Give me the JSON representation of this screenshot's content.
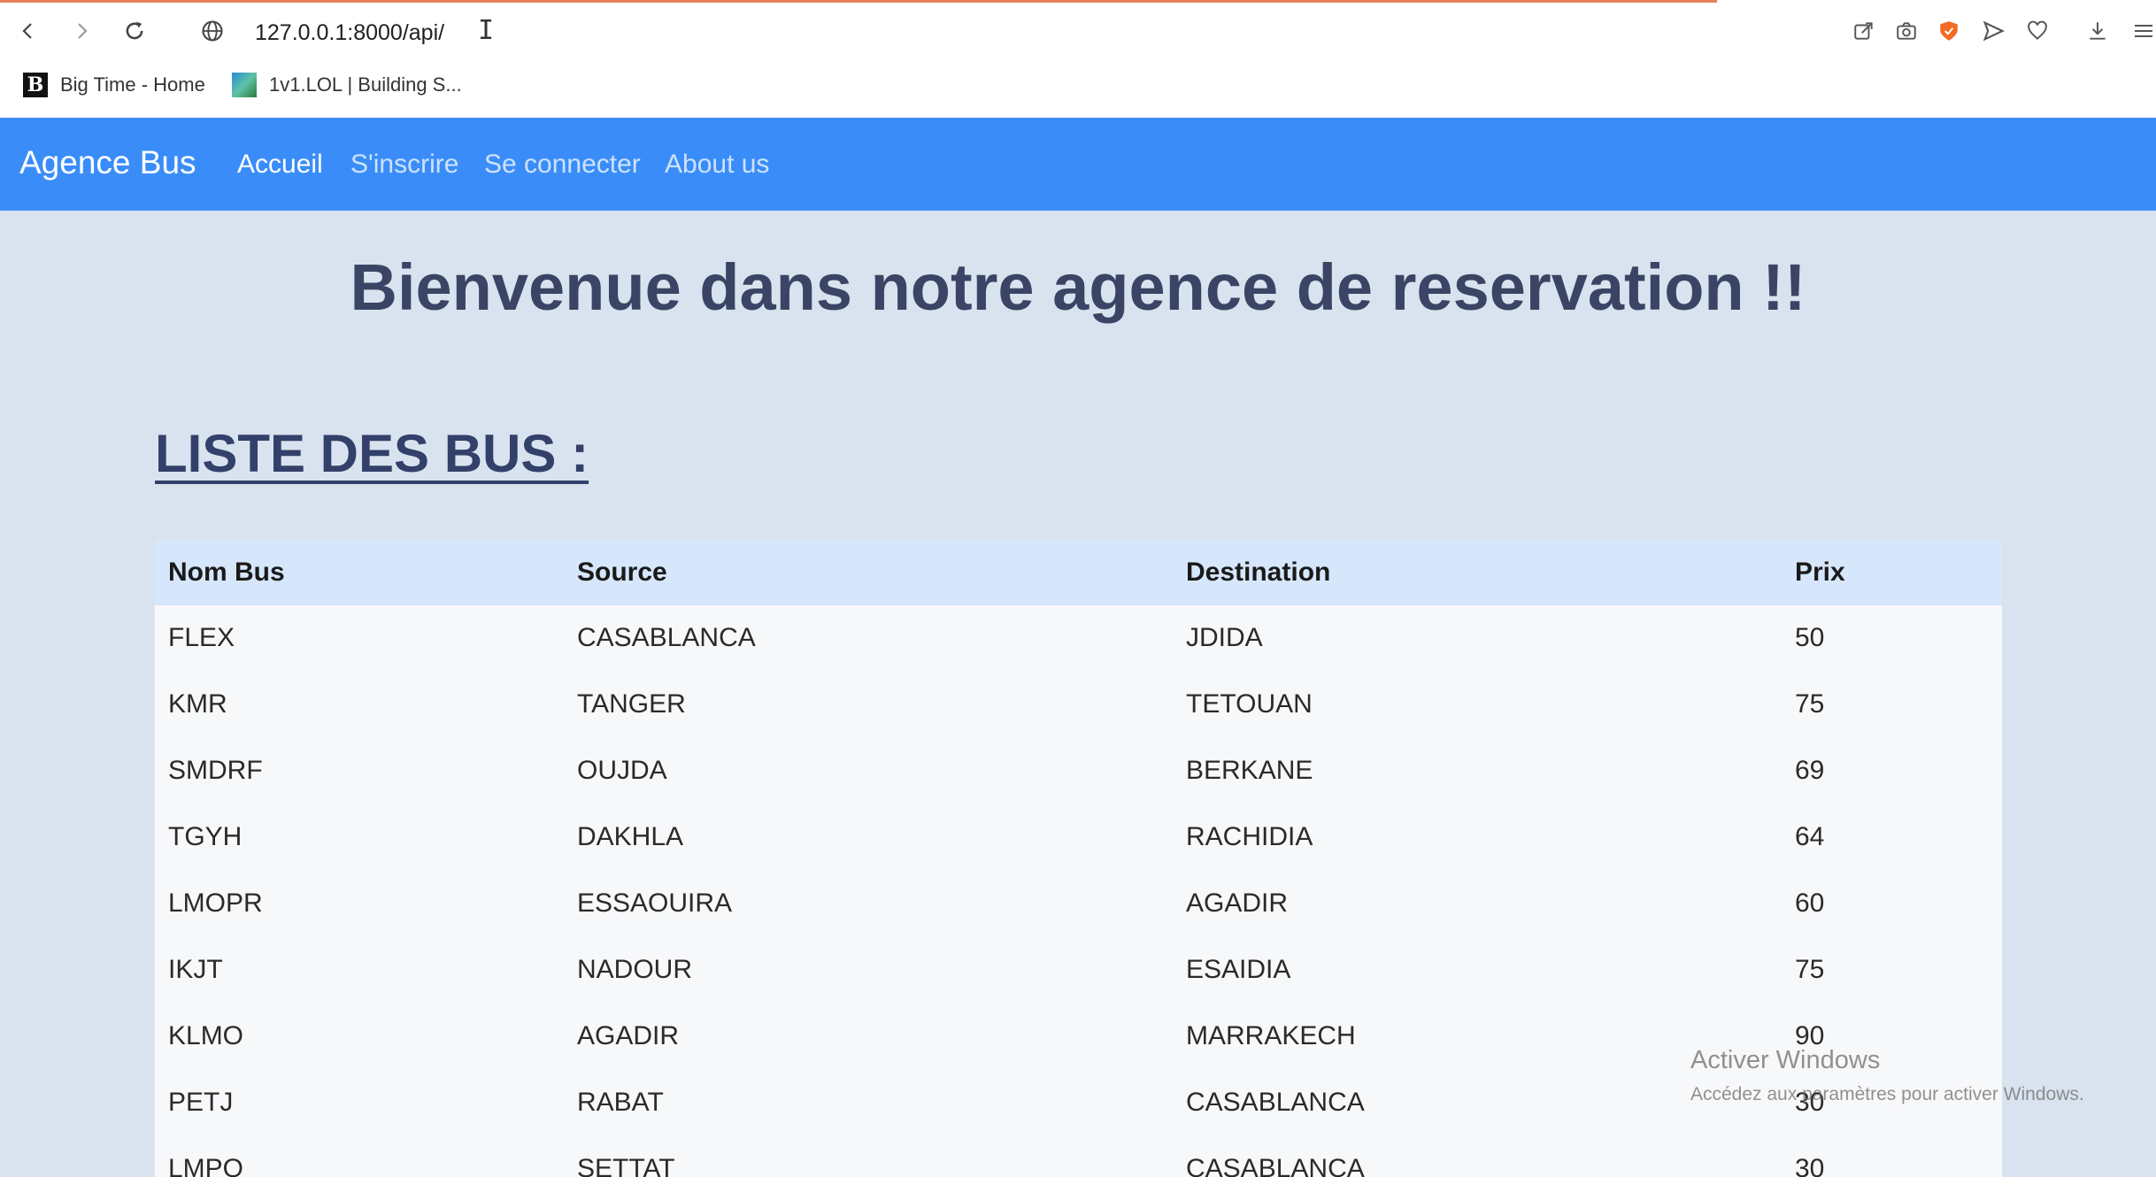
{
  "browser": {
    "url": "127.0.0.1:8000/api/",
    "bookmarks": [
      {
        "label": "Big Time - Home",
        "icon": "big-time-favicon"
      },
      {
        "label": "1v1.LOL | Building S...",
        "icon": "1v1lol-favicon"
      }
    ],
    "accent_loading": "#e7815a",
    "shield_color": "#f26a24"
  },
  "navbar": {
    "brand": "Agence Bus",
    "links": [
      "Accueil",
      "S'inscrire",
      "Se connecter",
      "About us"
    ],
    "active_index": 0,
    "background": "#3a8df8"
  },
  "page": {
    "headline": "Bienvenue dans notre agence de reservation !!",
    "section_title": "LISTE DES BUS :"
  },
  "table": {
    "headers": [
      "Nom Bus",
      "Source",
      "Destination",
      "Prix"
    ],
    "rows": [
      [
        "FLEX",
        "CASABLANCA",
        "JDIDA",
        "50"
      ],
      [
        "KMR",
        "TANGER",
        "TETOUAN",
        "75"
      ],
      [
        "SMDRF",
        "OUJDA",
        "BERKANE",
        "69"
      ],
      [
        "TGYH",
        "DAKHLA",
        "RACHIDIA",
        "64"
      ],
      [
        "LMOPR",
        "ESSAOUIRA",
        "AGADIR",
        "60"
      ],
      [
        "IKJT",
        "NADOUR",
        "ESAIDIA",
        "75"
      ],
      [
        "KLMO",
        "AGADIR",
        "MARRAKECH",
        "90"
      ],
      [
        "PETJ",
        "RABAT",
        "CASABLANCA",
        "30"
      ],
      [
        "LMPO",
        "SETTAT",
        "CASABLANCA",
        "30"
      ]
    ]
  },
  "watermark": {
    "title": "Activer Windows",
    "subtitle": "Accédez aux paramètres pour activer Windows."
  }
}
